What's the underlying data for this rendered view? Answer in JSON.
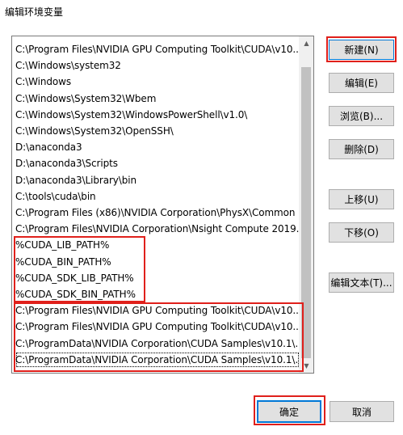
{
  "window": {
    "title": "编辑环境变量"
  },
  "paths": [
    "C:\\Program Files\\NVIDIA GPU Computing Toolkit\\CUDA\\v10....",
    "C:\\Windows\\system32",
    "C:\\Windows",
    "C:\\Windows\\System32\\Wbem",
    "C:\\Windows\\System32\\WindowsPowerShell\\v1.0\\",
    "C:\\Windows\\System32\\OpenSSH\\",
    "D:\\anaconda3",
    "D:\\anaconda3\\Scripts",
    "D:\\anaconda3\\Library\\bin",
    "C:\\tools\\cuda\\bin",
    "C:\\Program Files (x86)\\NVIDIA Corporation\\PhysX\\Common",
    "C:\\Program Files\\NVIDIA Corporation\\Nsight Compute 2019....",
    "%CUDA_LIB_PATH%",
    "%CUDA_BIN_PATH%",
    "%CUDA_SDK_LIB_PATH%",
    "%CUDA_SDK_BIN_PATH%",
    "C:\\Program Files\\NVIDIA GPU Computing Toolkit\\CUDA\\v10....",
    "C:\\Program Files\\NVIDIA GPU Computing Toolkit\\CUDA\\v10....",
    "C:\\ProgramData\\NVIDIA Corporation\\CUDA Samples\\v10.1\\...",
    "C:\\ProgramData\\NVIDIA Corporation\\CUDA Samples\\v10.1\\..."
  ],
  "buttons": {
    "new": "新建(N)",
    "edit": "编辑(E)",
    "browse": "浏览(B)...",
    "delete": "删除(D)",
    "move_up": "上移(U)",
    "move_down": "下移(O)",
    "edit_text": "编辑文本(T)...",
    "ok": "确定",
    "cancel": "取消"
  },
  "colors": {
    "highlight": "#e0201b",
    "accent": "#0078d7"
  }
}
